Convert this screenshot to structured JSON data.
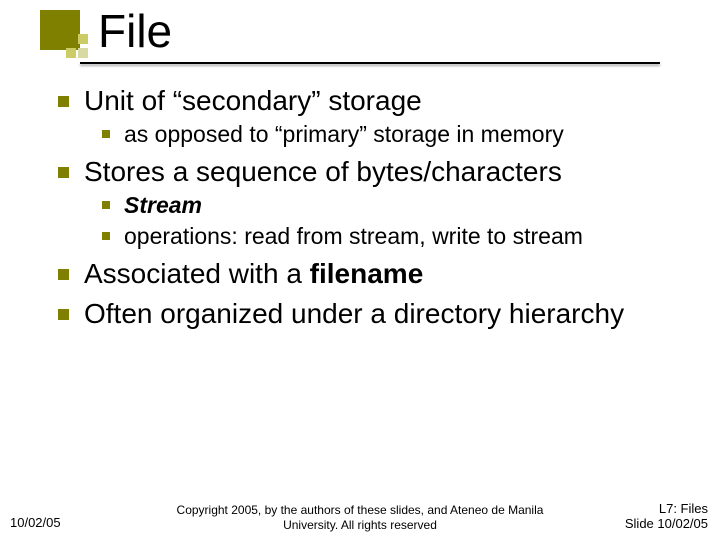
{
  "title": "File",
  "bullets": {
    "b1": "Unit of “secondary” storage",
    "b1_1": "as opposed to “primary” storage in memory",
    "b2": "Stores a sequence of bytes/characters",
    "b2_1_prefix": "Stream",
    "b2_2": "operations: read from stream, write to stream",
    "b3_prefix": "Associated with a ",
    "b3_bold": "filename",
    "b4": "Often organized under a directory hierarchy"
  },
  "footer": {
    "date": "10/02/05",
    "copyright": "Copyright 2005, by the authors of these slides, and Ateneo de Manila University. All rights reserved",
    "right_line1": "L7: Files",
    "right_line2": "Slide 10/02/05"
  }
}
